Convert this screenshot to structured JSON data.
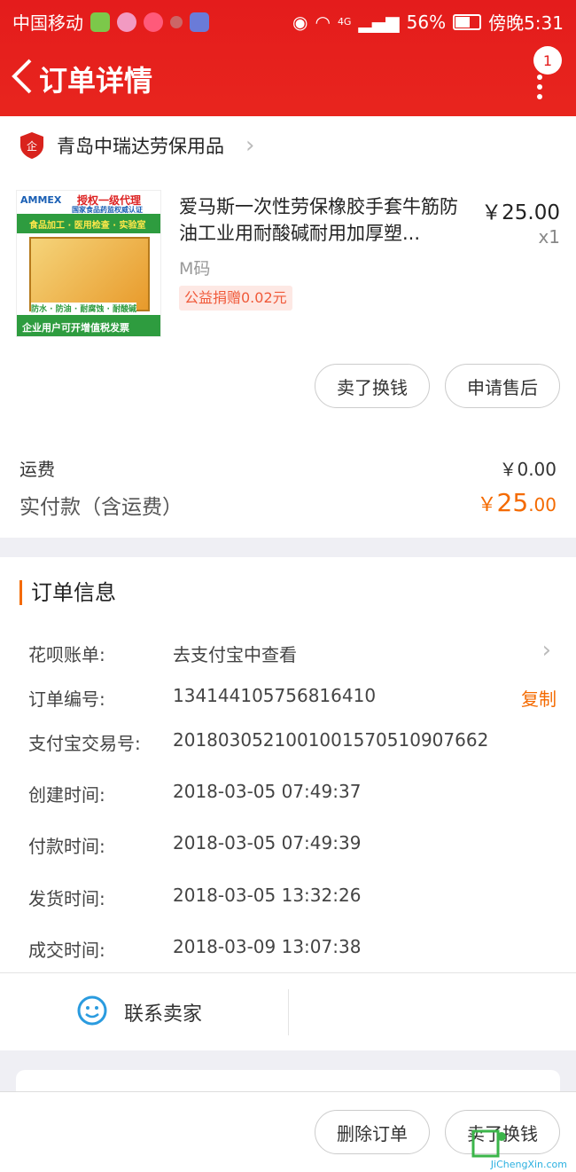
{
  "status": {
    "carrier": "中国移动",
    "network": "4G",
    "battery": "56%",
    "time": "傍晚5:31"
  },
  "nav": {
    "title": "订单详情",
    "badge_count": "1",
    "back_icon": "chevron-left-icon",
    "more_icon": "more-vertical-icon"
  },
  "shop": {
    "name": "青岛中瑞达劳保用品",
    "icon": "enterprise-shield-icon"
  },
  "product": {
    "name": "爱马斯一次性劳保橡胶手套牛筋防油工业用耐酸碱耐用加厚塑...",
    "price": "￥25.00",
    "qty": "x1",
    "spec": "M码",
    "charity": "公益捐赠0.02元",
    "thumb": {
      "brand": "AMMEX",
      "line1": "授权一级代理",
      "line2": "国家食品药监权威认证",
      "line3": "食品加工 · 医用检查 · 实验室",
      "line4": "防水 · 防油 · 耐腐蚀 · 耐酸碱",
      "line5": "企业用户可开增值税发票"
    }
  },
  "actions": {
    "sell": "卖了换钱",
    "after_sale": "申请售后"
  },
  "summary": {
    "shipping_label": "运费",
    "shipping_value": "￥0.00",
    "total_label": "实付款（含运费）",
    "total_currency": "￥",
    "total_int": "25",
    "total_dec": ".00"
  },
  "order_info": {
    "title": "订单信息",
    "rows": [
      {
        "label": "花呗账单:",
        "value": "去支付宝中查看"
      },
      {
        "label": "订单编号:",
        "value": "134144105756816410"
      },
      {
        "label": "支付宝交易号:",
        "value": "2018030521001001570510907662"
      },
      {
        "label": "创建时间:",
        "value": "2018-03-05 07:49:37"
      },
      {
        "label": "付款时间:",
        "value": "2018-03-05 07:49:39"
      },
      {
        "label": "发货时间:",
        "value": "2018-03-05 13:32:26"
      },
      {
        "label": "成交时间:",
        "value": "2018-03-09 13:07:38"
      }
    ],
    "copy": "复制"
  },
  "contact": {
    "label": "联系卖家",
    "icon": "chat-face-icon"
  },
  "bottom": {
    "delete": "删除订单",
    "sell": "卖了换钱"
  },
  "watermark": {
    "text": "JiChengXin.com"
  },
  "colors": {
    "header": "#e41c1c",
    "accent": "#f46a00"
  }
}
